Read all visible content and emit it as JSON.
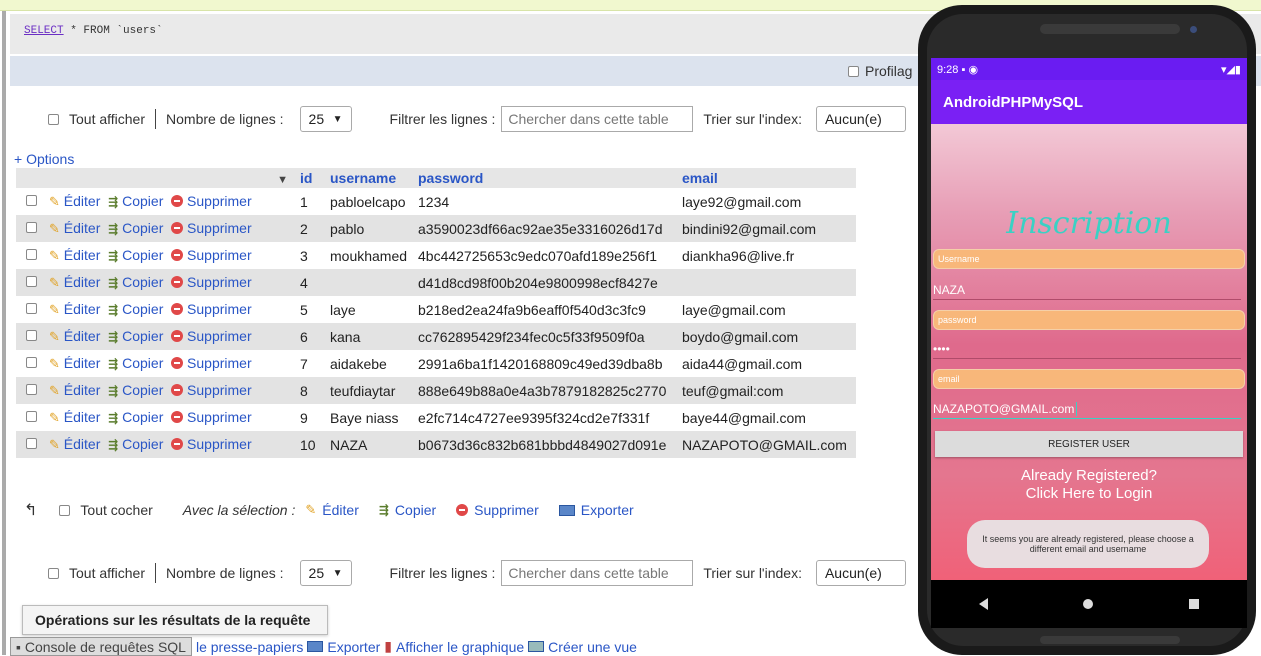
{
  "sql": {
    "keyword": "SELECT",
    "rest": " * FROM `users`"
  },
  "profil_label": "Profilag",
  "nav": {
    "show_all": "Tout afficher",
    "rows_label": "Nombre de lignes :",
    "rows_value": "25",
    "filter_label": "Filtrer les lignes :",
    "filter_placeholder": "Chercher dans cette table",
    "sort_label": "Trier sur l'index:",
    "sort_value": "Aucun(e)"
  },
  "options_link": "+ Options",
  "table": {
    "headers": [
      "id",
      "username",
      "password",
      "email"
    ],
    "actions": {
      "edit": "Éditer",
      "copy": "Copier",
      "delete": "Supprimer"
    },
    "rows": [
      {
        "id": "1",
        "username": "pabloelcapo",
        "password": "1234",
        "email": "laye92@gmail.com"
      },
      {
        "id": "2",
        "username": "pablo",
        "password": "a3590023df66ac92ae35e3316026d17d",
        "email": "bindini92@gmail.com"
      },
      {
        "id": "3",
        "username": "moukhamed",
        "password": "4bc442725653c9edc070afd189e256f1",
        "email": "diankha96@live.fr"
      },
      {
        "id": "4",
        "username": "",
        "password": "d41d8cd98f00b204e9800998ecf8427e",
        "email": ""
      },
      {
        "id": "5",
        "username": "laye",
        "password": "b218ed2ea24fa9b6eaff0f540d3c3fc9",
        "email": "laye@gmail.com"
      },
      {
        "id": "6",
        "username": "kana",
        "password": "cc762895429f234fec0c5f33f9509f0a",
        "email": "boydo@gmail.com"
      },
      {
        "id": "7",
        "username": "aidakebe",
        "password": "2991a6ba1f1420168809c49ed39dba8b",
        "email": "aida44@gmail.com"
      },
      {
        "id": "8",
        "username": "teufdiaytar",
        "password": "888e649b88a0e4a3b7879182825c2770",
        "email": "teuf@gmail:com"
      },
      {
        "id": "9",
        "username": "Baye niass",
        "password": "e2fc714c4727ee9395f324cd2e7f331f",
        "email": "baye44@gmail.com"
      },
      {
        "id": "10",
        "username": "NAZA",
        "password": "b0673d36c832b681bbbd4849027d091e",
        "email": "NAZAPOTO@GMAIL.com"
      }
    ]
  },
  "selection": {
    "check_all": "Tout cocher",
    "with_selection": "Avec la sélection :",
    "edit": "Éditer",
    "copy": "Copier",
    "delete": "Supprimer",
    "export": "Exporter"
  },
  "operations_title": "Opérations sur les résultats de la requête",
  "footer": {
    "console": "Console de requêtes SQL",
    "clipboard": "le presse-papiers",
    "export": "Exporter",
    "chart": "Afficher le graphique",
    "view": "Créer une vue"
  },
  "phone": {
    "time": "9:28",
    "app_title": "AndroidPHPMySQL",
    "heading": "Inscription",
    "username_label": "Username",
    "username_value": "NAZA",
    "password_label": "password",
    "password_value": "••••",
    "email_label": "email",
    "email_value": "NAZAPOTO@GMAIL.com",
    "register_button": "REGISTER USER",
    "already_line1": "Already Registered?",
    "already_line2": "Click Here to Login",
    "toast": "It seems you are already registered, please choose a different email and username"
  }
}
